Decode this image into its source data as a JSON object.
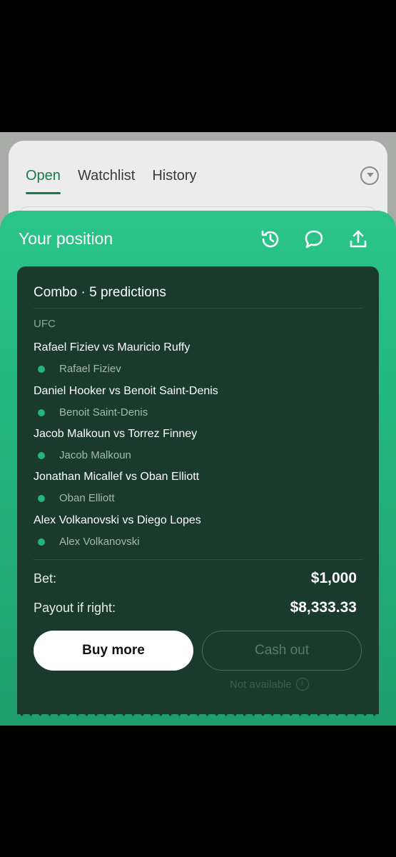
{
  "tabs": [
    {
      "label": "Open",
      "active": true
    },
    {
      "label": "Watchlist",
      "active": false
    },
    {
      "label": "History",
      "active": false
    }
  ],
  "sheet": {
    "title": "Your position",
    "icons": [
      "history-icon",
      "comment-icon",
      "share-icon"
    ]
  },
  "ticket": {
    "title": "Combo · 5 predictions",
    "league": "UFC",
    "predictions": [
      {
        "matchup": "Rafael Fiziev vs Mauricio Ruffy",
        "pick": "Rafael Fiziev"
      },
      {
        "matchup": "Daniel Hooker vs Benoit Saint-Denis",
        "pick": "Benoit Saint-Denis"
      },
      {
        "matchup": "Jacob Malkoun vs Torrez Finney",
        "pick": "Jacob Malkoun"
      },
      {
        "matchup": "Jonathan Micallef vs Oban Elliott",
        "pick": "Oban Elliott"
      },
      {
        "matchup": "Alex Volkanovski vs Diego Lopes",
        "pick": "Alex Volkanovski"
      }
    ],
    "bet_label": "Bet:",
    "bet_value": "$1,000",
    "payout_label": "Payout if right:",
    "payout_value": "$8,333.33",
    "buy_more_label": "Buy more",
    "cash_out_label": "Cash out",
    "not_available_label": "Not available",
    "info_icon": "i"
  },
  "colors": {
    "accent": "#157a4b",
    "sheet_green": "#23b47e",
    "ticket_bg": "#193a2d"
  }
}
